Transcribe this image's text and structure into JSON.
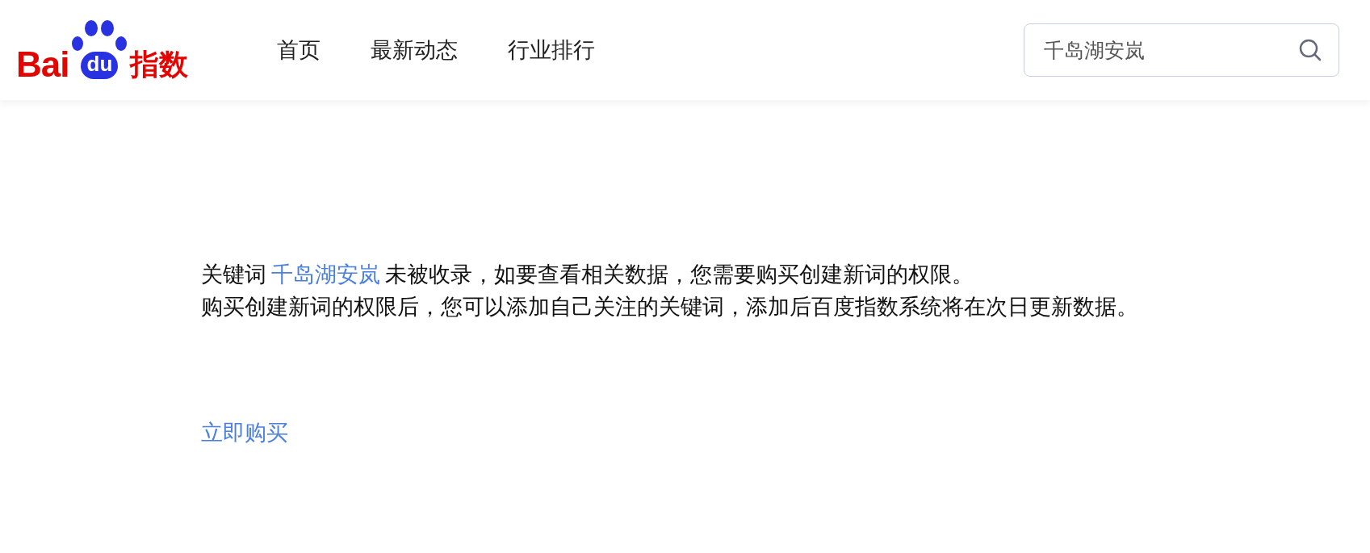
{
  "logo": {
    "left": "Bai",
    "paw": "du",
    "right": "指数"
  },
  "nav": [
    {
      "label": "首页"
    },
    {
      "label": "最新动态"
    },
    {
      "label": "行业排行"
    }
  ],
  "search": {
    "value": "千岛湖安岚"
  },
  "notice": {
    "before": "关键词",
    "keyword": "千岛湖安岚",
    "after": "未被收录，如要查看相关数据，您需要购买创建新词的权限。",
    "second": "购买创建新词的权限后，您可以添加自己关注的关键词，添加后百度指数系统将在次日更新数据。"
  },
  "buy_link": "立即购买"
}
